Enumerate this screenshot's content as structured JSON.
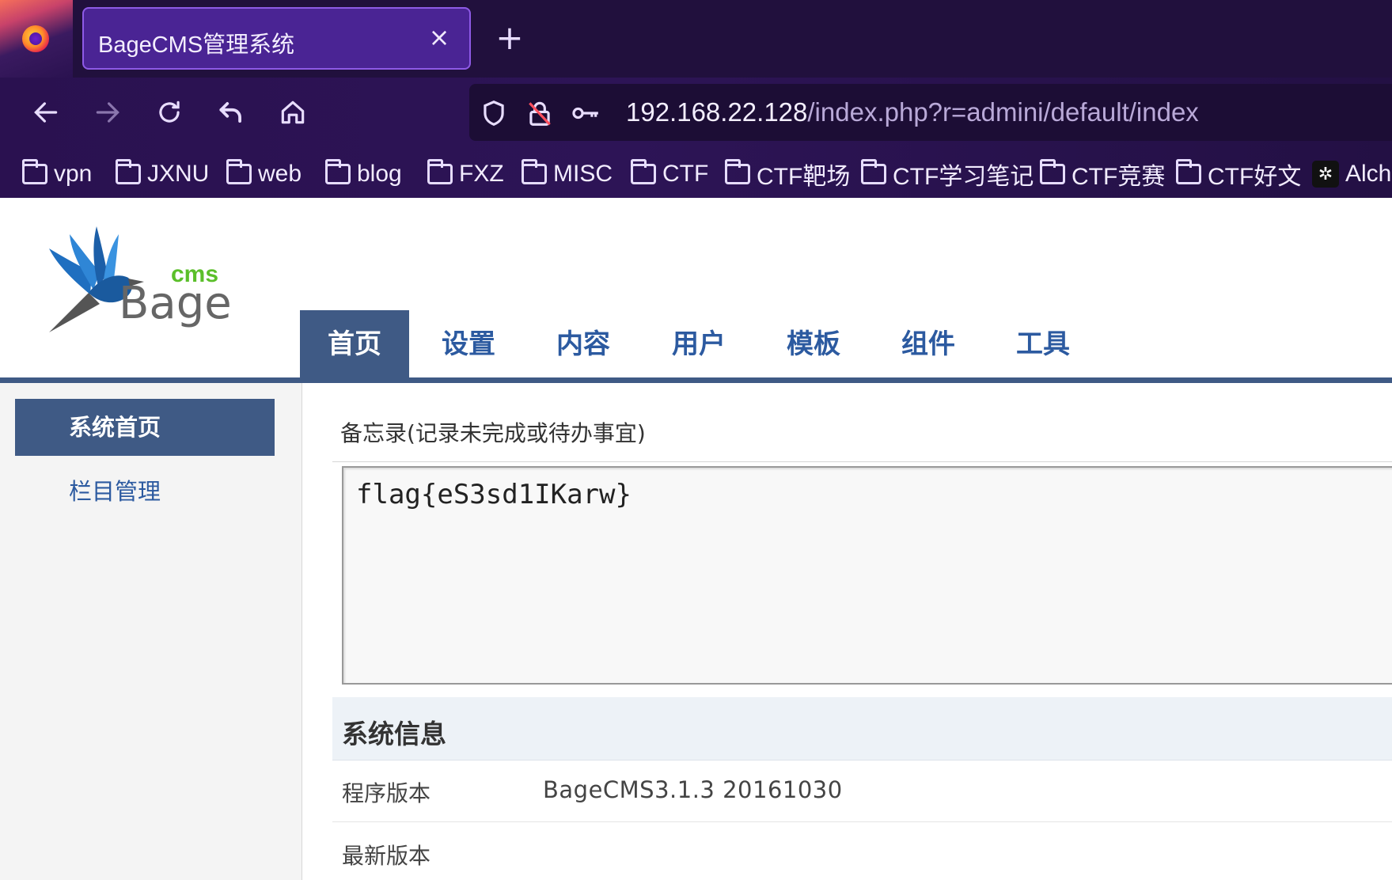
{
  "browser": {
    "tab_title": "BageCMS管理系统",
    "tab_close": "×",
    "new_tab": "+",
    "url_host": "192.168.22.128",
    "url_path": "/index.php?r=admini/default/index",
    "icons": [
      "firefox-logo",
      "back-arrow-icon",
      "forward-arrow-icon",
      "reload-icon",
      "undo-icon",
      "home-icon",
      "shield-icon",
      "lock-insecure-icon",
      "key-icon"
    ],
    "bookmarks": [
      {
        "label": "vpn",
        "icon": "folder-icon"
      },
      {
        "label": "JXNU",
        "icon": "folder-icon"
      },
      {
        "label": "web",
        "icon": "folder-icon"
      },
      {
        "label": "blog",
        "icon": "folder-icon"
      },
      {
        "label": "FXZ",
        "icon": "folder-icon"
      },
      {
        "label": "MISC",
        "icon": "folder-icon"
      },
      {
        "label": "CTF",
        "icon": "folder-icon"
      },
      {
        "label": "CTF靶场",
        "icon": "folder-icon"
      },
      {
        "label": "CTF学习笔记",
        "icon": "folder-icon"
      },
      {
        "label": "CTF竞赛",
        "icon": "folder-icon"
      },
      {
        "label": "CTF好文",
        "icon": "folder-icon"
      },
      {
        "label": "Alch",
        "icon": "openai-icon"
      }
    ],
    "colors": {
      "chrome_bg": "#2d1456",
      "tab_active": "#4a2494",
      "tab_border": "#8e5ae6"
    }
  },
  "site": {
    "logo_text": "Bage",
    "logo_sup": "cms",
    "nav": [
      "首页",
      "设置",
      "内容",
      "用户",
      "模板",
      "组件",
      "工具"
    ],
    "nav_active": "首页",
    "sidebar": {
      "home": "系统首页",
      "column_manage": "栏目管理"
    },
    "memo": {
      "title": "备忘录(记录未完成或待办事宜)",
      "content": "flag{eS3sd1IKarw}"
    },
    "sysinfo": {
      "title": "系统信息",
      "rows": [
        {
          "label": "程序版本",
          "value": "BageCMS3.1.3 20161030"
        },
        {
          "label": "最新版本",
          "value": ""
        }
      ]
    },
    "colors": {
      "primary": "#3f5a85",
      "link": "#2c5aa0",
      "logo_green": "#5bbf2a",
      "logo_blue": "#1f6fc0"
    }
  }
}
